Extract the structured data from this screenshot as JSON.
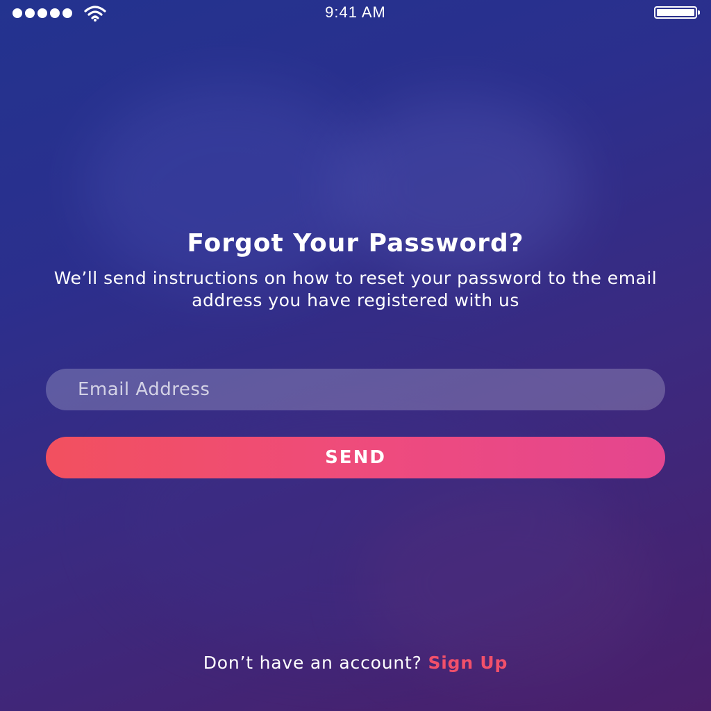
{
  "status_bar": {
    "time": "9:41 AM",
    "signal_icon": "signal-dots-icon",
    "wifi_icon": "wifi-icon",
    "battery_icon": "battery-icon"
  },
  "screen": {
    "title": "Forgot Your Password?",
    "subtitle": "We’ll send instructions on how to reset your password to the email address you have registered with us",
    "email_placeholder": "Email Address",
    "email_value": "",
    "send_label": "SEND",
    "footer_prompt": "Don’t have an account?",
    "signup_label": "Sign Up"
  },
  "colors": {
    "accent": "#f2506a",
    "button_start": "#f2505f",
    "button_end": "#e4468f",
    "background_top": "#23338f",
    "background_bottom": "#4a1f6a"
  }
}
